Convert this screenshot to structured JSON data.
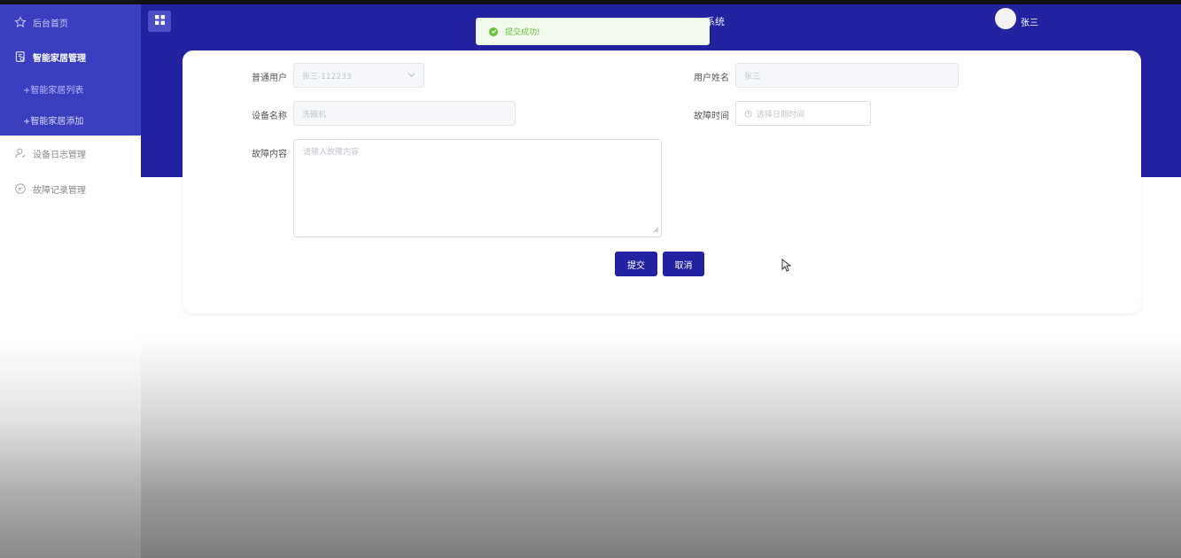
{
  "header": {
    "title_fragment": "系统",
    "username": "张三"
  },
  "sidebar": {
    "items": [
      {
        "label": "后台首页",
        "icon": "star-icon"
      },
      {
        "label": "智能家居管理",
        "icon": "document-icon"
      },
      {
        "label": "设备日志管理",
        "icon": "user-icon"
      },
      {
        "label": "故障记录管理",
        "icon": "chat-icon"
      }
    ],
    "subitems": [
      {
        "label": "+智能家居列表"
      },
      {
        "label": "+智能家居添加"
      }
    ]
  },
  "toast": {
    "message": "提交成功!",
    "color": "#67c23a"
  },
  "form": {
    "user_label": "普通用户",
    "user_value": "张三-112233",
    "name_label": "用户姓名",
    "name_value": "张三",
    "device_label": "设备名称",
    "device_value": "洗碗机",
    "time_label": "故障时间",
    "time_placeholder": "选择日期时间",
    "content_label": "故障内容",
    "content_placeholder": "请输入故障内容"
  },
  "buttons": {
    "submit": "提交",
    "cancel": "取消"
  },
  "colors": {
    "primary": "#2323a1",
    "sidebar_active": "#3b3fbf"
  }
}
